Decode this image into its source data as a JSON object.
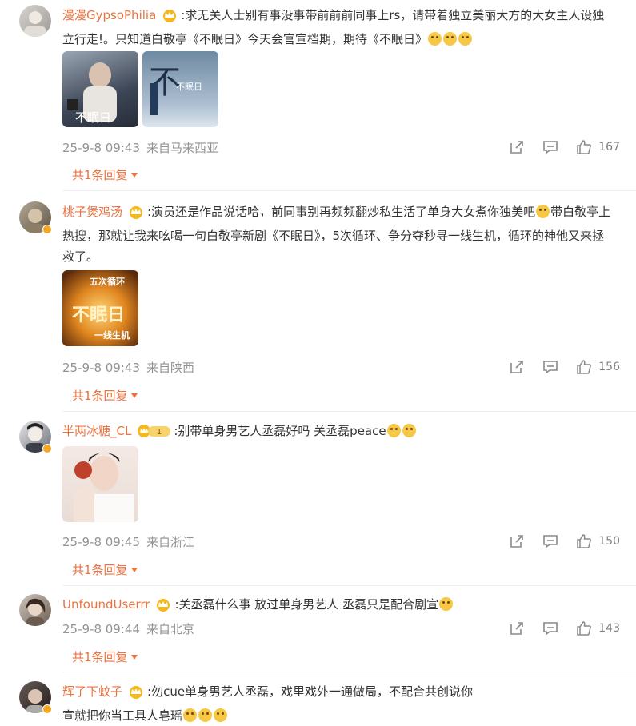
{
  "comments": [
    {
      "username": "漫漫GypsoPhilia",
      "text": ":求无关人士别有事没事带前前前同事上rs，请带着独立美丽大方的大女主人设独立行走!。只知道白敬亭《不眠日》今天会官宣档期，期待《不眠日》",
      "emoji_count": 3,
      "date": "25-9-8 09:43",
      "location": "来自马来西亚",
      "likes": "167",
      "replies": "共1条回复",
      "image_text_1": "不眠日",
      "image_text_2": "不眠日"
    },
    {
      "username": "桃子煲鸡汤",
      "text_part1": ":演员还是作品说话哈，前同事别再频频翻炒私生活了单身大女煮你独美吧",
      "text_part2": "带白敬亭上热搜，那就让我来吆喝一句白敬亭新剧《不眠日》，5次循环、争分夺秒寻一线生机，循环的神他又来拯救了。",
      "date": "25-9-8 09:43",
      "location": "来自陕西",
      "likes": "156",
      "replies": "共1条回复",
      "image_text_top": "五次循环",
      "image_text_mid": "不眠日",
      "image_text_bottom": "一线生机"
    },
    {
      "username": "半两冰糖_CL",
      "level": "1",
      "text": ":别带单身男艺人丞磊好吗 关丞磊peace",
      "emoji_count": 2,
      "date": "25-9-8 09:45",
      "location": "来自浙江",
      "likes": "150",
      "replies": "共1条回复"
    },
    {
      "username": "UnfoundUserrr",
      "text": ":关丞磊什么事 放过单身男艺人 丞磊只是配合剧宣",
      "emoji_count": 1,
      "date": "25-9-8 09:44",
      "location": "来自北京",
      "likes": "143",
      "replies": "共1条回复"
    },
    {
      "username": "辉了下蚊子",
      "text_line1": ":勿cue单身男艺人丞磊，戏里戏外一通做局，不配合共创说你",
      "text_line2": "宣就把你当工具人皂瑶",
      "emoji_count": 3
    }
  ],
  "icons": {
    "share": "share-icon",
    "comment": "comment-icon",
    "like": "thumbs-up-icon"
  },
  "colors": {
    "username": "#eb7340",
    "meta": "#939393",
    "text": "#333333"
  }
}
